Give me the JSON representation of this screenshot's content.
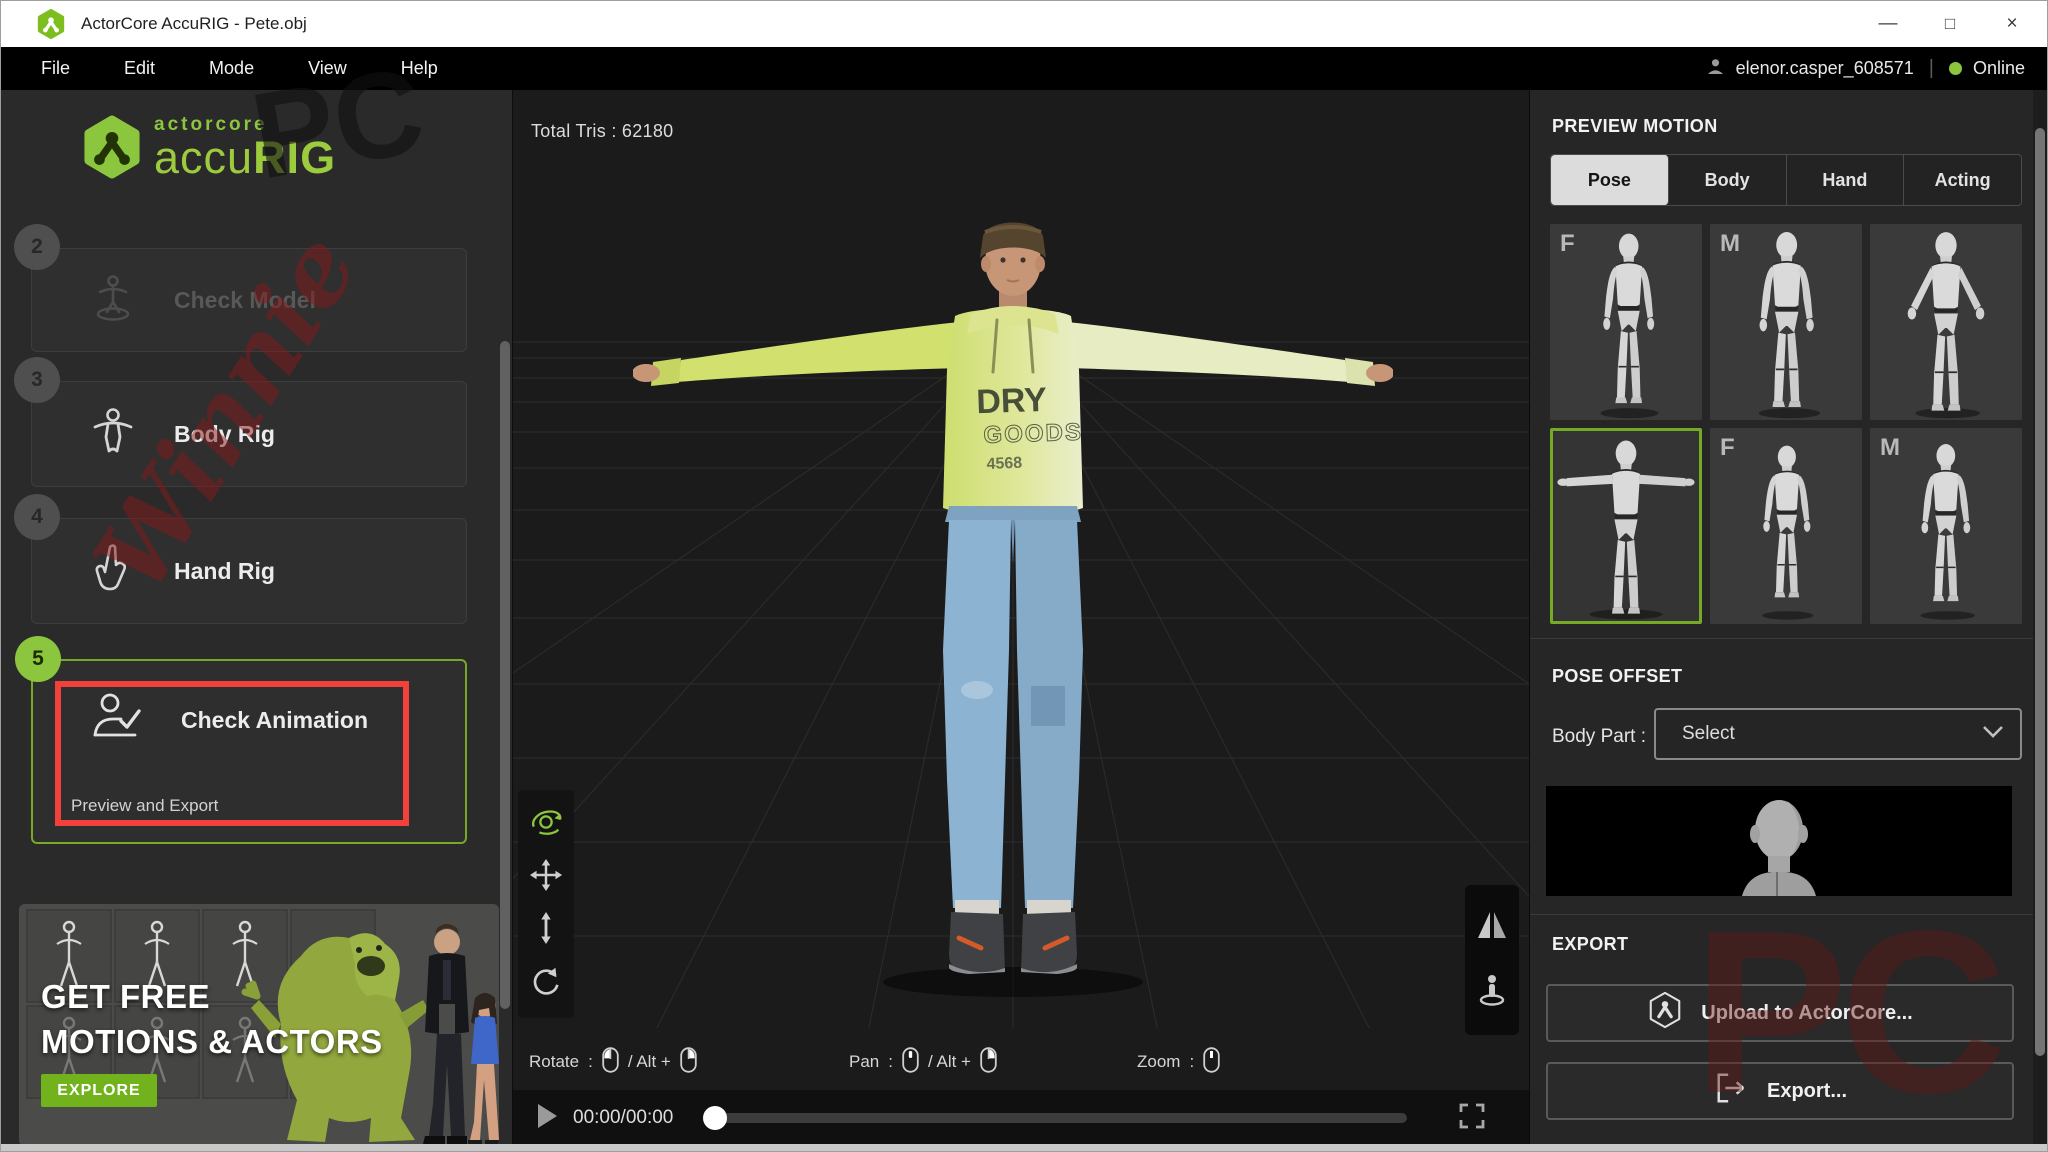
{
  "titlebar": {
    "title": "ActorCore AccuRIG - Pete.obj",
    "minimize": "—",
    "maximize": "□",
    "close": "×"
  },
  "menubar": {
    "items": [
      "File",
      "Edit",
      "Mode",
      "View",
      "Help"
    ],
    "username": "elenor.casper_608571",
    "separator": "|",
    "online": "Online"
  },
  "sidebar": {
    "logo": {
      "brand": "actorcore",
      "accu": "accu",
      "rig": "RIG"
    },
    "steps": [
      {
        "num": "2",
        "label": "Check Model"
      },
      {
        "num": "3",
        "label": "Body Rig"
      },
      {
        "num": "4",
        "label": "Hand Rig"
      },
      {
        "num": "5",
        "label": "Check Animation",
        "sub": "Preview and Export"
      }
    ],
    "promo": {
      "line1": "GET FREE",
      "line2": "MOTIONS & ACTORS",
      "cta": "EXPLORE"
    }
  },
  "viewport": {
    "total_tris": "Total Tris : 62180",
    "print": {
      "l1": "DRY",
      "l2": "GOODS",
      "l3": "4568"
    },
    "hints": {
      "rotate": "Rotate",
      "pan": "Pan",
      "zoom": "Zoom",
      "colon": ":",
      "alt": "/  Alt  +"
    },
    "playback": {
      "time": "00:00/00:00"
    }
  },
  "panel": {
    "preview_motion_title": "PREVIEW MOTION",
    "tabs": [
      "Pose",
      "Body",
      "Hand",
      "Acting"
    ],
    "pose_tags": [
      "F",
      "M",
      "",
      "",
      "F",
      "M"
    ],
    "pose_offset_title": "POSE OFFSET",
    "body_part_label": "Body Part :",
    "body_part_value": "Select",
    "export_title": "EXPORT",
    "upload_btn": "Upload to ActorCore...",
    "export_btn": "Export..."
  },
  "watermark": {
    "script": "Winnie",
    "initials": "PC"
  },
  "colors": {
    "accent_green": "#8CC63E",
    "selection_green": "#76A928",
    "highlight_red": "#F2413B",
    "online_green": "#8CC63E"
  }
}
